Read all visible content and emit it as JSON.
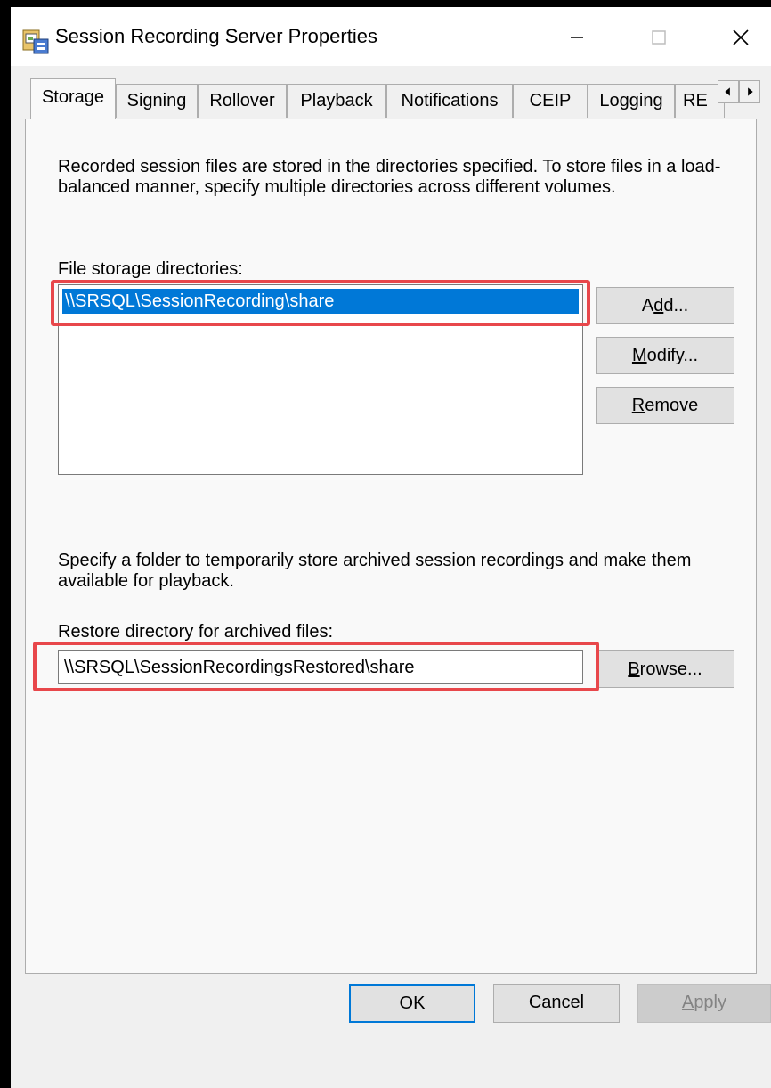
{
  "window": {
    "title": "Session Recording Server Properties",
    "icon": "server-properties-icon",
    "controls": [
      "minimize-icon",
      "maximize-icon",
      "close-icon"
    ]
  },
  "tabs": [
    {
      "label": "Storage",
      "active": true
    },
    {
      "label": "Signing",
      "active": false
    },
    {
      "label": "Rollover",
      "active": false
    },
    {
      "label": "Playback",
      "active": false
    },
    {
      "label": "Notifications",
      "active": false
    },
    {
      "label": "CEIP",
      "active": false
    },
    {
      "label": "Logging",
      "active": false
    },
    {
      "label": "RE",
      "active": false
    }
  ],
  "storage": {
    "description": "Recorded session files are stored in the directories specified. To store files in a load-balanced manner, specify multiple directories across different volumes.",
    "files_label": "File storage directories:",
    "directories": [
      "\\\\SRSQL\\SessionRecording\\share"
    ],
    "buttons": {
      "add": {
        "pre": "A",
        "key": "d",
        "post": "d..."
      },
      "modify": {
        "pre": "",
        "key": "M",
        "post": "odify..."
      },
      "remove": {
        "pre": "",
        "key": "R",
        "post": "emove"
      }
    },
    "archive_description": "Specify a folder to temporarily store archived session recordings and make them available for playback.",
    "restore_label": "Restore directory for archived files:",
    "restore_value": "\\\\SRSQL\\SessionRecordingsRestored\\share",
    "browse": {
      "pre": "",
      "key": "B",
      "post": "rowse..."
    }
  },
  "footer": {
    "ok": "OK",
    "cancel": "Cancel",
    "apply": {
      "pre": "",
      "key": "A",
      "post": "pply"
    }
  },
  "colors": {
    "highlight": "#e8474b",
    "selection": "#0078d7",
    "default_button_border": "#0078d7"
  }
}
